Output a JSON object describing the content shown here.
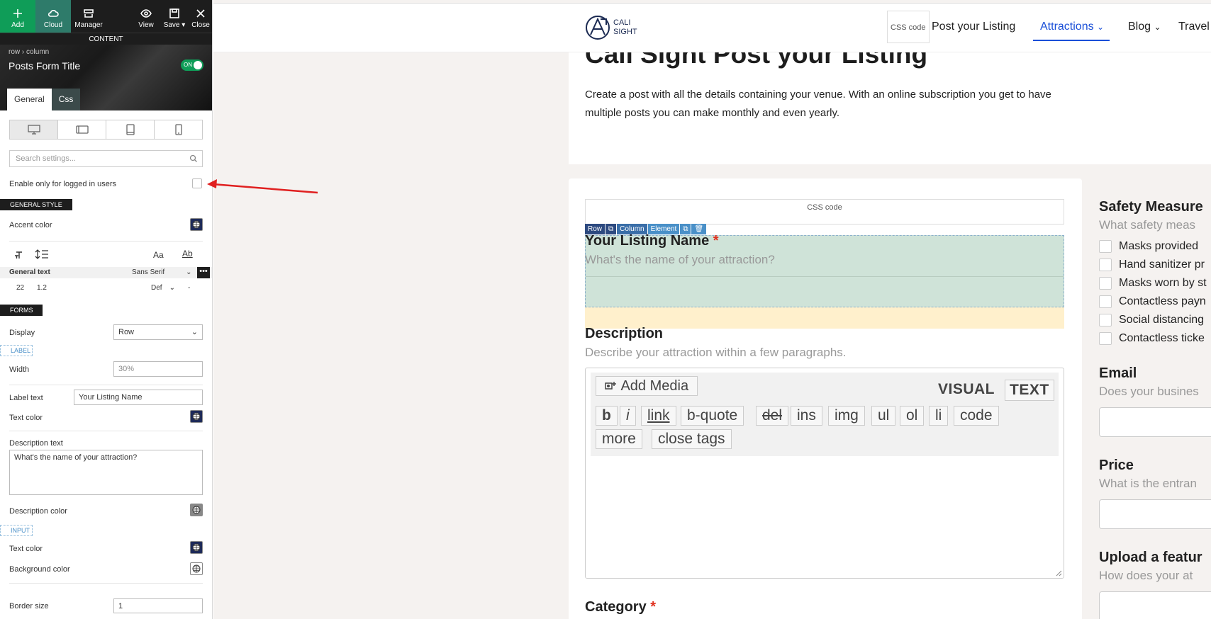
{
  "toolbar": {
    "add": "Add",
    "cloud": "Cloud",
    "manager": "Manager",
    "view": "View",
    "save": "Save",
    "close": "Close",
    "content_bar": "CONTENT"
  },
  "panel": {
    "breadcrumb": "row  ›  column",
    "title": "Posts Form Title",
    "toggle": "ON",
    "tabs": [
      "General",
      "Css"
    ],
    "search_placeholder": "Search settings...",
    "logged_in_label": "Enable only for logged in users",
    "general_style": "GENERAL STYLE",
    "accent_color": "Accent color",
    "font_aa": "Aa",
    "font_ab": "Ab",
    "general_text": "General text",
    "font_family": "Sans Serif",
    "font_size": "22",
    "line_height": "1.2",
    "font_weight": "Def",
    "dash": "-",
    "forms": "FORMS",
    "display_label": "Display",
    "display_value": "Row",
    "label_head": "LABEL",
    "width_label": "Width",
    "width_placeholder": "30%",
    "label_text_label": "Label text",
    "label_text_value": "Your Listing Name",
    "text_color": "Text color",
    "description_text_label": "Description text",
    "description_text_value": "What's the name of your attraction?",
    "description_color": "Description color",
    "input_head": "INPUT",
    "input_text_color": "Text color",
    "background_color": "Background color",
    "border_size_label": "Border size",
    "border_size_value": "1"
  },
  "site": {
    "logo_line1": "CALI",
    "logo_line2": "SIGHT",
    "css_code": "CSS code",
    "nav": [
      "Post your Listing",
      "Attractions",
      "Blog",
      "Travel"
    ],
    "heading": "Cali Sight Post your Listing",
    "intro": "Create a post with all the details containing your venue. With an online subscription you get to have multiple posts you can make monthly and even yearly."
  },
  "form": {
    "css_code": "CSS code",
    "el_toolbar": [
      "Row",
      "Column",
      "Element"
    ],
    "listing_label": "Your Listing Name",
    "required": "*",
    "listing_desc": "What's the name of your attraction?",
    "description_label": "Description",
    "description_desc": "Describe your attraction within a few paragraphs.",
    "add_media": "Add Media",
    "visual": "VISUAL",
    "text": "TEXT",
    "quicktags": [
      "b",
      "i",
      "link",
      "b-quote",
      "del",
      "ins",
      "img",
      "ul",
      "ol",
      "li",
      "code",
      "more",
      "close tags"
    ],
    "category_label": "Category"
  },
  "right_col": {
    "safety_label": "Safety Measure",
    "safety_desc": "What safety meas",
    "checkboxes": [
      "Masks provided",
      "Hand sanitizer pr",
      "Masks worn by st",
      "Contactless payn",
      "Social distancing",
      "Contactless ticke"
    ],
    "email_label": "Email",
    "email_desc": "Does your busines",
    "price_label": "Price",
    "price_desc": "What is the entran",
    "upload_label": "Upload a featur",
    "upload_desc": "How does your at"
  },
  "colors": {
    "accent": "#0f9d58",
    "nav_active": "#1a4fd8",
    "required": "#e0301e",
    "selection": "#cfe3d8",
    "arrow": "#e02020"
  }
}
